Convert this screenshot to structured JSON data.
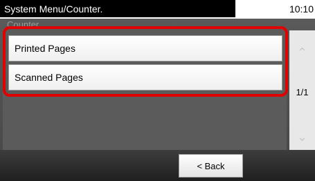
{
  "header": {
    "title": "System Menu/Counter.",
    "time": "10:10"
  },
  "screen": {
    "subtitle": "Counter"
  },
  "menu": {
    "items": [
      {
        "label": "Printed Pages"
      },
      {
        "label": "Scanned Pages"
      }
    ]
  },
  "pager": {
    "page": "1/1",
    "up_icon": "chevron-up-icon",
    "down_icon": "chevron-down-icon"
  },
  "footer": {
    "back_label": "< Back"
  },
  "colors": {
    "highlight": "#e00000",
    "background": "#4a4a4a",
    "title_bar": "#000000"
  }
}
